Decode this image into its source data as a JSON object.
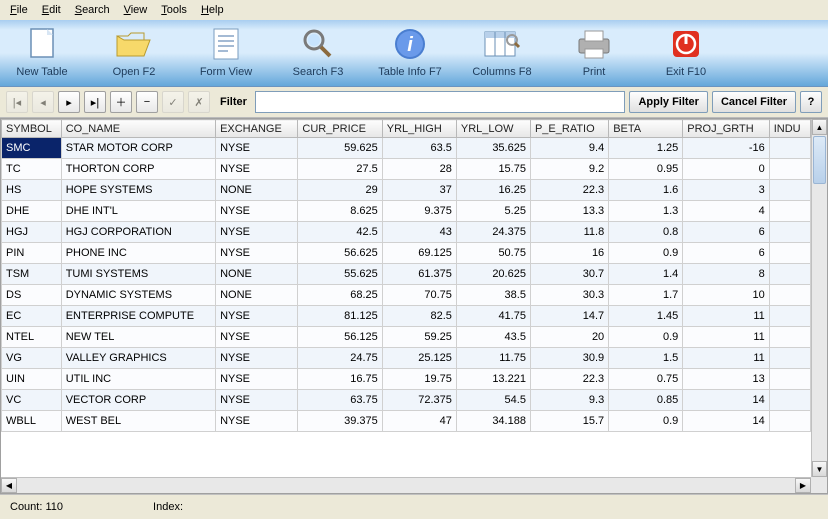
{
  "menu": {
    "items": [
      "File",
      "Edit",
      "Search",
      "View",
      "Tools",
      "Help"
    ]
  },
  "toolbar": {
    "items": [
      {
        "label": "New Table",
        "icon": "new"
      },
      {
        "label": "Open F2",
        "icon": "open"
      },
      {
        "label": "Form View",
        "icon": "form"
      },
      {
        "label": "Search F3",
        "icon": "search"
      },
      {
        "label": "Table Info F7",
        "icon": "info"
      },
      {
        "label": "Columns F8",
        "icon": "columns"
      },
      {
        "label": "Print",
        "icon": "print"
      },
      {
        "label": "Exit F10",
        "icon": "exit"
      }
    ]
  },
  "filter": {
    "label": "Filter",
    "value": "",
    "apply": "Apply Filter",
    "cancel": "Cancel Filter",
    "help": "?"
  },
  "columns": [
    "SYMBOL",
    "CO_NAME",
    "EXCHANGE",
    "CUR_PRICE",
    "YRL_HIGH",
    "YRL_LOW",
    "P_E_RATIO",
    "BETA",
    "PROJ_GRTH",
    "INDU"
  ],
  "rows": [
    {
      "SYMBOL": "SMC",
      "CO_NAME": "STAR MOTOR CORP",
      "EXCHANGE": "NYSE",
      "CUR_PRICE": "59.625",
      "YRL_HIGH": "63.5",
      "YRL_LOW": "35.625",
      "P_E_RATIO": "9.4",
      "BETA": "1.25",
      "PROJ_GRTH": "-16"
    },
    {
      "SYMBOL": "TC",
      "CO_NAME": "THORTON CORP",
      "EXCHANGE": "NYSE",
      "CUR_PRICE": "27.5",
      "YRL_HIGH": "28",
      "YRL_LOW": "15.75",
      "P_E_RATIO": "9.2",
      "BETA": "0.95",
      "PROJ_GRTH": "0"
    },
    {
      "SYMBOL": "HS",
      "CO_NAME": "HOPE SYSTEMS",
      "EXCHANGE": "NONE",
      "CUR_PRICE": "29",
      "YRL_HIGH": "37",
      "YRL_LOW": "16.25",
      "P_E_RATIO": "22.3",
      "BETA": "1.6",
      "PROJ_GRTH": "3"
    },
    {
      "SYMBOL": "DHE",
      "CO_NAME": "DHE INT'L",
      "EXCHANGE": "NYSE",
      "CUR_PRICE": "8.625",
      "YRL_HIGH": "9.375",
      "YRL_LOW": "5.25",
      "P_E_RATIO": "13.3",
      "BETA": "1.3",
      "PROJ_GRTH": "4"
    },
    {
      "SYMBOL": "HGJ",
      "CO_NAME": "HGJ CORPORATION",
      "EXCHANGE": "NYSE",
      "CUR_PRICE": "42.5",
      "YRL_HIGH": "43",
      "YRL_LOW": "24.375",
      "P_E_RATIO": "11.8",
      "BETA": "0.8",
      "PROJ_GRTH": "6"
    },
    {
      "SYMBOL": "PIN",
      "CO_NAME": "PHONE INC",
      "EXCHANGE": "NYSE",
      "CUR_PRICE": "56.625",
      "YRL_HIGH": "69.125",
      "YRL_LOW": "50.75",
      "P_E_RATIO": "16",
      "BETA": "0.9",
      "PROJ_GRTH": "6"
    },
    {
      "SYMBOL": "TSM",
      "CO_NAME": "TUMI SYSTEMS",
      "EXCHANGE": "NONE",
      "CUR_PRICE": "55.625",
      "YRL_HIGH": "61.375",
      "YRL_LOW": "20.625",
      "P_E_RATIO": "30.7",
      "BETA": "1.4",
      "PROJ_GRTH": "8"
    },
    {
      "SYMBOL": "DS",
      "CO_NAME": "DYNAMIC SYSTEMS",
      "EXCHANGE": "NONE",
      "CUR_PRICE": "68.25",
      "YRL_HIGH": "70.75",
      "YRL_LOW": "38.5",
      "P_E_RATIO": "30.3",
      "BETA": "1.7",
      "PROJ_GRTH": "10"
    },
    {
      "SYMBOL": "EC",
      "CO_NAME": "ENTERPRISE COMPUTE",
      "EXCHANGE": "NYSE",
      "CUR_PRICE": "81.125",
      "YRL_HIGH": "82.5",
      "YRL_LOW": "41.75",
      "P_E_RATIO": "14.7",
      "BETA": "1.45",
      "PROJ_GRTH": "11"
    },
    {
      "SYMBOL": "NTEL",
      "CO_NAME": "NEW TEL",
      "EXCHANGE": "NYSE",
      "CUR_PRICE": "56.125",
      "YRL_HIGH": "59.25",
      "YRL_LOW": "43.5",
      "P_E_RATIO": "20",
      "BETA": "0.9",
      "PROJ_GRTH": "11"
    },
    {
      "SYMBOL": "VG",
      "CO_NAME": "VALLEY GRAPHICS",
      "EXCHANGE": "NYSE",
      "CUR_PRICE": "24.75",
      "YRL_HIGH": "25.125",
      "YRL_LOW": "11.75",
      "P_E_RATIO": "30.9",
      "BETA": "1.5",
      "PROJ_GRTH": "11"
    },
    {
      "SYMBOL": "UIN",
      "CO_NAME": "UTIL INC",
      "EXCHANGE": "NYSE",
      "CUR_PRICE": "16.75",
      "YRL_HIGH": "19.75",
      "YRL_LOW": "13.221",
      "P_E_RATIO": "22.3",
      "BETA": "0.75",
      "PROJ_GRTH": "13"
    },
    {
      "SYMBOL": "VC",
      "CO_NAME": "VECTOR CORP",
      "EXCHANGE": "NYSE",
      "CUR_PRICE": "63.75",
      "YRL_HIGH": "72.375",
      "YRL_LOW": "54.5",
      "P_E_RATIO": "9.3",
      "BETA": "0.85",
      "PROJ_GRTH": "14"
    },
    {
      "SYMBOL": "WBLL",
      "CO_NAME": "WEST BEL",
      "EXCHANGE": "NYSE",
      "CUR_PRICE": "39.375",
      "YRL_HIGH": "47",
      "YRL_LOW": "34.188",
      "P_E_RATIO": "15.7",
      "BETA": "0.9",
      "PROJ_GRTH": "14"
    }
  ],
  "status": {
    "count_label": "Count:",
    "count_value": "110",
    "index_label": "Index:",
    "index_value": ""
  }
}
